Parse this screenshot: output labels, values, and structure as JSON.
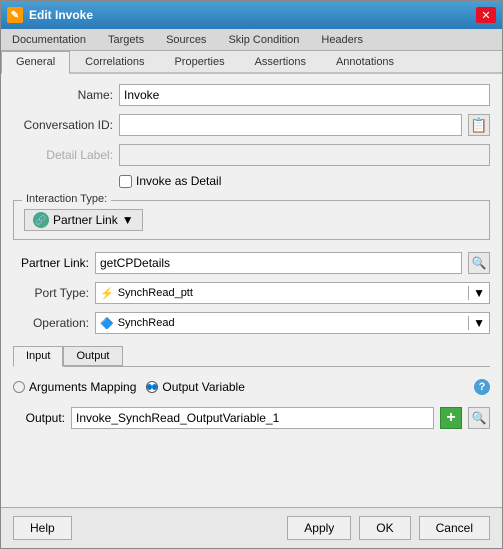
{
  "window": {
    "title": "Edit Invoke",
    "close_label": "✕"
  },
  "tabs_row1": {
    "tabs": [
      {
        "label": "Documentation",
        "active": false
      },
      {
        "label": "Targets",
        "active": false
      },
      {
        "label": "Sources",
        "active": false
      },
      {
        "label": "Skip Condition",
        "active": false
      },
      {
        "label": "Headers",
        "active": false
      }
    ]
  },
  "tabs_row2": {
    "tabs": [
      {
        "label": "General",
        "active": true
      },
      {
        "label": "Correlations",
        "active": false
      },
      {
        "label": "Properties",
        "active": false
      },
      {
        "label": "Assertions",
        "active": false
      },
      {
        "label": "Annotations",
        "active": false
      }
    ]
  },
  "fields": {
    "name_label": "Name:",
    "name_value": "Invoke",
    "conversation_label": "Conversation ID:",
    "conversation_value": "",
    "detail_label_text": "Detail Label:",
    "detail_value": "",
    "invoke_as_detail": "Invoke as Detail"
  },
  "interaction": {
    "group_label": "Interaction Type:",
    "partner_link_btn": "Partner Link"
  },
  "partner_link": {
    "label": "Partner Link:",
    "value": "getCPDetails"
  },
  "port_type": {
    "label": "Port Type:",
    "value": "SynchRead_ptt"
  },
  "operation": {
    "label": "Operation:",
    "value": "SynchRead"
  },
  "input_tabs": {
    "tabs": [
      {
        "label": "Input",
        "active": true
      },
      {
        "label": "Output",
        "active": false
      }
    ]
  },
  "radio": {
    "arguments_mapping": "Arguments Mapping",
    "output_variable": "Output Variable",
    "selected": "output_variable"
  },
  "output": {
    "label": "Output:",
    "value": "Invoke_SynchRead_OutputVariable_1"
  },
  "bottom_bar": {
    "help_label": "Help",
    "apply_label": "Apply",
    "ok_label": "OK",
    "cancel_label": "Cancel"
  },
  "icons": {
    "search": "🔍",
    "browse": "📋",
    "green_plus": "+",
    "help_circle": "?",
    "partner_link_icon": "🔗",
    "port_icon": "⚡",
    "operation_icon": "🔷"
  }
}
